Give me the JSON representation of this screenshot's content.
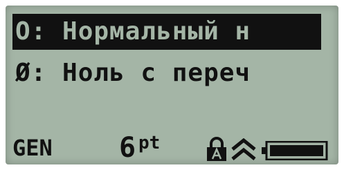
{
  "display": {
    "lines": [
      {
        "text": "O: Нормальный н",
        "selected": true
      },
      {
        "text": "Ø: Ноль с переч",
        "selected": false
      }
    ]
  },
  "status_bar": {
    "mode": "GEN",
    "font_size_value": "6",
    "font_size_unit": "pt",
    "icons": [
      "caps-lock-icon",
      "caps-arrow-icon",
      "battery-icon"
    ],
    "battery_level": 1.0
  },
  "colors": {
    "lcd_background": "#a4b5a6",
    "lcd_ink": "#111111"
  }
}
